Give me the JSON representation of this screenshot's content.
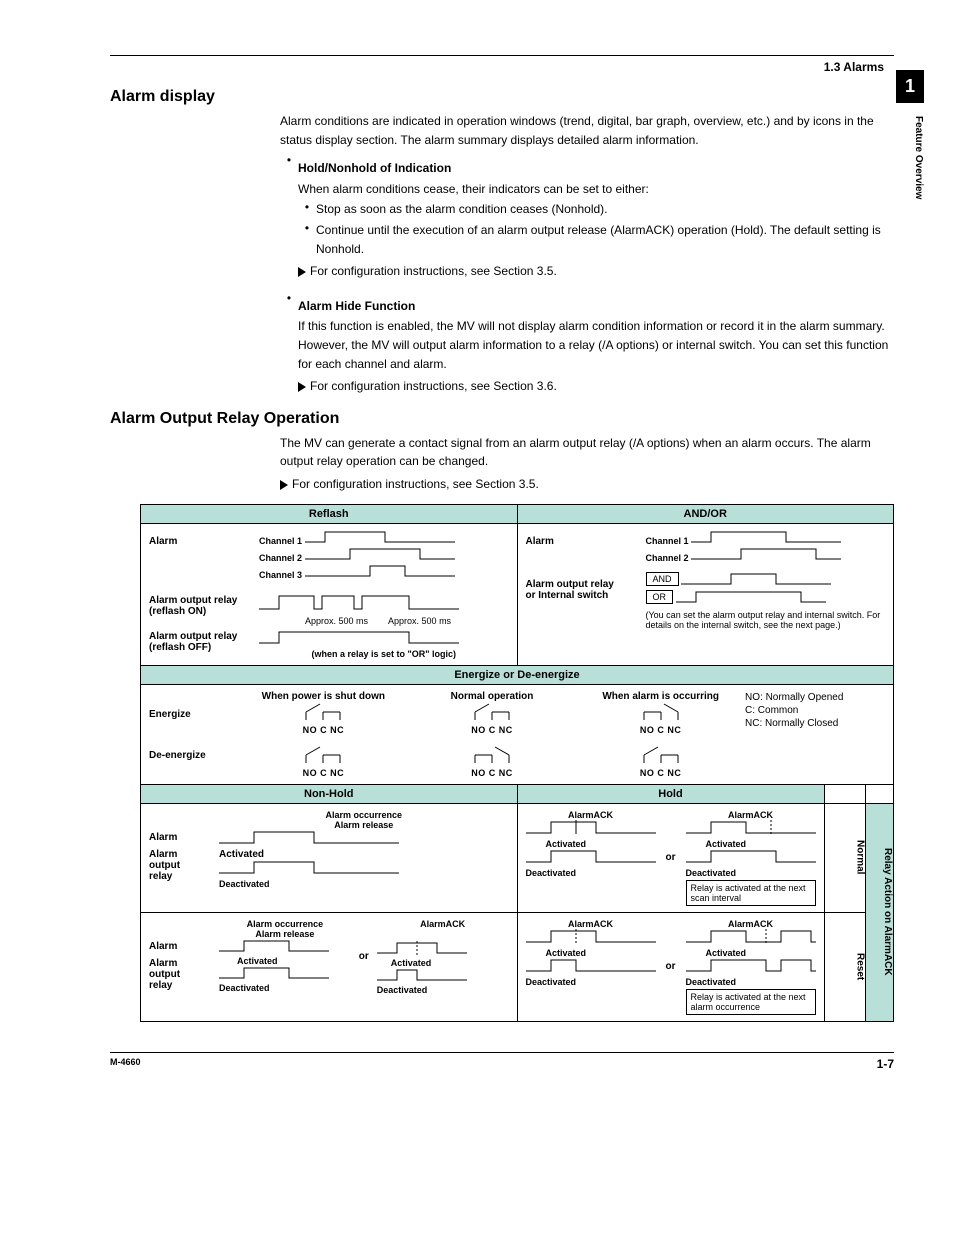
{
  "header": {
    "section_ref": "1.3  Alarms",
    "chapter_tab": "1",
    "side_label": "Feature Overview"
  },
  "h1": "Alarm display",
  "p1": "Alarm conditions are indicated in operation windows (trend, digital, bar graph, overview, etc.) and by icons in the status display section. The alarm summary displays detailed alarm information.",
  "bullet_hold_head": "Hold/Nonhold of Indication",
  "bullet_hold_intro": "When alarm conditions cease, their indicators can be set to either:",
  "bullet_hold_1": "Stop as soon as the alarm condition ceases (Nonhold).",
  "bullet_hold_2": "Continue until the execution of an alarm output release (AlarmACK) operation (Hold). The default setting is Nonhold.",
  "xref35a": "For configuration instructions, see Section 3.5.",
  "bullet_hide_head": "Alarm Hide Function",
  "bullet_hide_body": "If this function is enabled, the MV will not display alarm condition information or record it in the alarm summary. However, the MV will output alarm information to a relay (/A options) or internal switch. You can set this function for each channel and alarm.",
  "xref36": "For configuration instructions, see Section 3.6.",
  "h2": "Alarm Output Relay Operation",
  "p2": "The MV can generate a contact signal from an alarm output relay (/A options) when an alarm occurs. The alarm output relay operation can be changed.",
  "xref35b": "For configuration instructions, see Section 3.5.",
  "table": {
    "reflash": {
      "title": "Reflash",
      "alarm": "Alarm",
      "ch1": "Channel 1",
      "ch2": "Channel 2",
      "ch3": "Channel 3",
      "relay_on": "Alarm output relay (reflash ON)",
      "relay_off": "Alarm output relay (reflash OFF)",
      "approx1": "Approx. 500 ms",
      "approx2": "Approx. 500 ms",
      "note": "(when a relay is set to \"OR\" logic)"
    },
    "andor": {
      "title": "AND/OR",
      "alarm": "Alarm",
      "ch1": "Channel 1",
      "ch2": "Channel 2",
      "relay_or_switch": "Alarm output relay or Internal switch",
      "and": "AND",
      "or": "OR",
      "note": "(You can set the alarm output relay and internal switch. For details on the internal switch, see the next page.)"
    },
    "energize": {
      "title": "Energize or De-energize",
      "col1": "When power is shut down",
      "col2": "Normal operation",
      "col3": "When alarm is occurring",
      "row1": "Energize",
      "row2": "De-energize",
      "legend_no": "NO: Normally Opened",
      "legend_c": "C:   Common",
      "legend_nc": "NC: Normally Closed",
      "labels": "NO C  NC"
    },
    "nonhold": {
      "title": "Non-Hold"
    },
    "hold": {
      "title": "Hold"
    },
    "bottom": {
      "alarm_occurrence": "Alarm occurrence",
      "alarm_release": "Alarm release",
      "alarm": "Alarm",
      "alarm_output_relay": "Alarm output relay",
      "activated": "Activated",
      "deactivated": "Deactivated",
      "alarmack": "AlarmACK",
      "or": "or",
      "note_scan": "Relay is activated at the next scan interval",
      "note_alarm": "Relay is activated at the next alarm occurrence",
      "side_normal": "Normal",
      "side_reset": "Reset",
      "side_relay_action": "Relay Action on AlarmACK"
    }
  },
  "footer": {
    "left": "M-4660",
    "right": "1-7"
  }
}
